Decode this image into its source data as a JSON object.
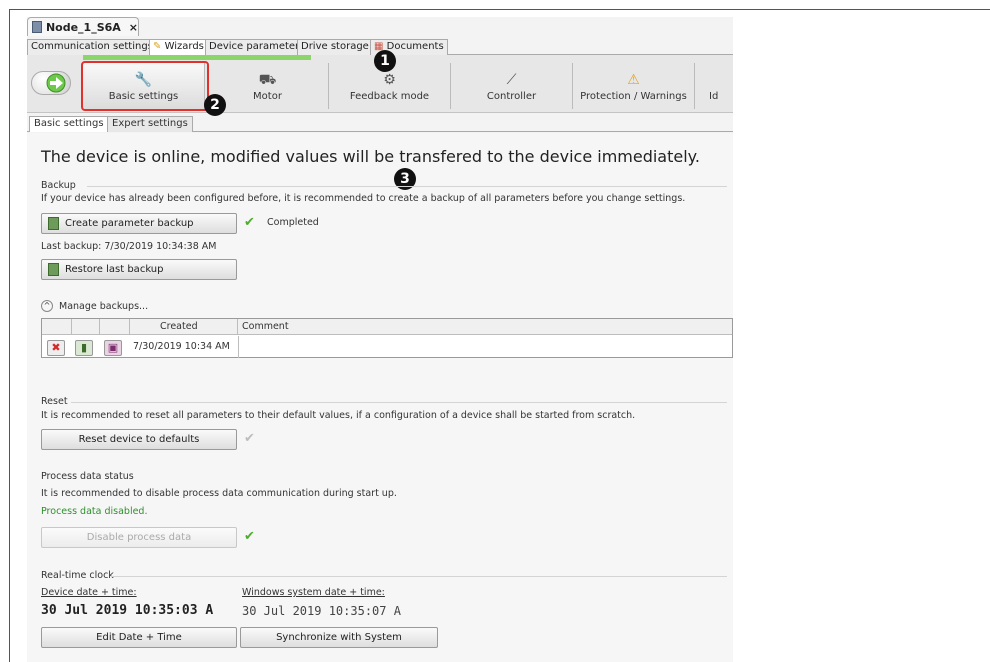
{
  "window": {
    "doc_tab": "Node_1_S6A",
    "close": "×"
  },
  "tabs": [
    {
      "label": "Communication settings"
    },
    {
      "label": "Wizards"
    },
    {
      "label": "Device parameters"
    },
    {
      "label": "Drive storage"
    },
    {
      "label": "Documents"
    }
  ],
  "steps": [
    {
      "label": "Basic settings"
    },
    {
      "label": "Motor"
    },
    {
      "label": "Feedback mode"
    },
    {
      "label": "Controller"
    },
    {
      "label": "Protection / Warnings"
    },
    {
      "label": "Id"
    }
  ],
  "markers": {
    "one": "1",
    "two": "2",
    "three": "3"
  },
  "inner_tabs": [
    {
      "label": "Basic settings"
    },
    {
      "label": "Expert settings"
    }
  ],
  "headline": "The device is online, modified  values will be transfered to the device immediately.",
  "backup": {
    "group": "Backup",
    "desc": "If your device has already been configured before, it is recommended to create a backup of all parameters before you change settings.",
    "create_btn": "Create parameter backup",
    "status": "Completed",
    "last_backup": "Last backup:  7/30/2019 10:34:38 AM",
    "restore_btn": "Restore last backup",
    "manage": "Manage backups...",
    "table": {
      "col_created": "Created",
      "col_comment": "Comment",
      "row_created": "7/30/2019 10:34 AM"
    }
  },
  "reset": {
    "group": "Reset",
    "desc": "It is recommended to reset all parameters to their default values, if a configuration of a device shall be started from scratch.",
    "btn": "Reset device to defaults"
  },
  "process": {
    "group": "Process data status",
    "desc": "It is recommended to disable process data communication during start up.",
    "status": "Process data disabled.",
    "btn": "Disable process data"
  },
  "clock": {
    "group": "Real-time clock",
    "device_label": "Device date + time:",
    "windows_label": "Windows system date + time:",
    "device_value": "30 Jul 2019 10:35:03 A",
    "windows_value": "30 Jul 2019 10:35:07 A",
    "edit_btn": "Edit Date + Time",
    "sync_btn": "Synchronize with System"
  },
  "colors": {
    "highlight": "#e2302b",
    "ok": "#4caf2a",
    "progress": "#8bd56a"
  }
}
